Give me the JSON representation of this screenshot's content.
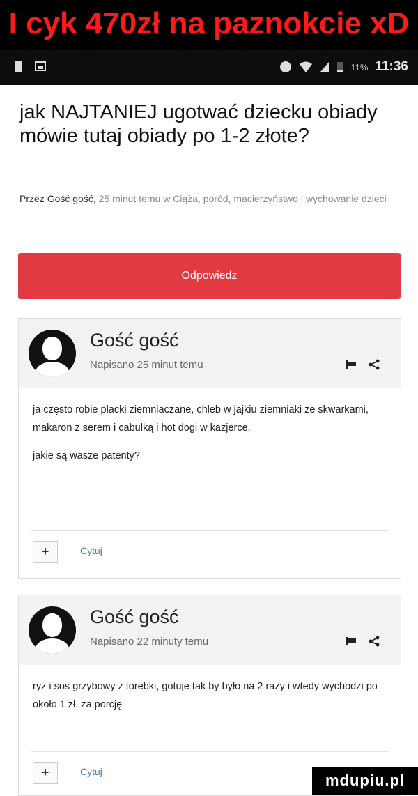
{
  "banner": {
    "caption": "I cyk 470zł na paznokcie xD"
  },
  "statusbar": {
    "time": "11:36",
    "battery": "11%"
  },
  "topic": {
    "title": "jak NAJTANIEJ ugotwać dziecku obiady mówie tutaj obiady po 1-2 złote?",
    "meta_prefix": "Przez",
    "author": "Gość gość,",
    "meta_rest": "25 minut temu w Ciąża, poród, macierzyństwo i wychowanie dzieci"
  },
  "reply_button": "Odpowiedz",
  "posts": [
    {
      "author": "Gość gość",
      "time": "Napisano 25 minut temu",
      "paragraphs": [
        "ja często robie placki ziemniaczane, chleb w jajkiu ziemniaki ze skwarkami, makaron z serem i cabulką i hot dogi w kazjerce.",
        "jakie są wasze patenty?"
      ],
      "plus": "+",
      "quote": "Cytuj"
    },
    {
      "author": "Gość gość",
      "time": "Napisano 22 minuty temu",
      "paragraphs": [
        "ryż i sos grzybowy z torebki, gotuje tak by było na 2 razy i wtedy wychodzi po około 1 zł. za porcję"
      ],
      "plus": "+",
      "quote": "Cytuj"
    }
  ],
  "watermark": "mdupiu.pl"
}
